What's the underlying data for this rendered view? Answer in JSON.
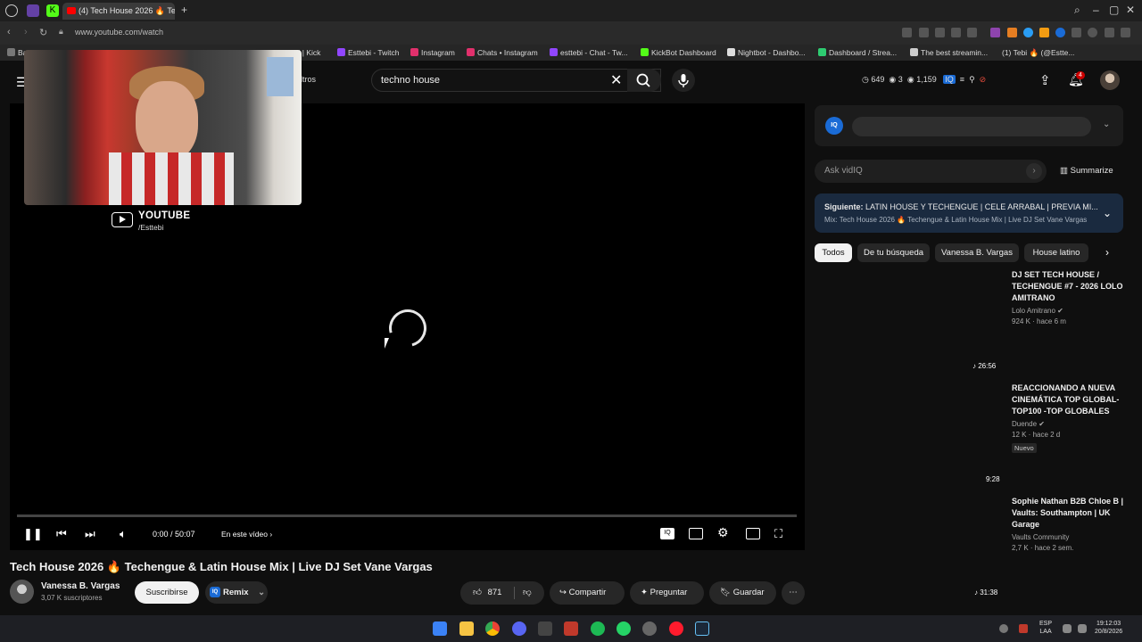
{
  "browser": {
    "active_tab_title": "(4) Tech House 2026 🔥 Te",
    "url": "www.youtube.com/watch",
    "bookmarks": [
      "Ba",
      "ebi | Kick",
      "Esttebi - Twitch",
      "Instagram",
      "Chats • Instagram",
      "esttebi - Chat - Tw...",
      "KickBot Dashboard",
      "Nightbot - Dashbo...",
      "Dashboard / Strea...",
      "The best streamin...",
      "(1) Tebi 🔥 (@Estte..."
    ]
  },
  "masthead": {
    "filters_label": "ltros",
    "search_value": "techno house",
    "stats": {
      "a": "649",
      "b": "3",
      "c": "1,159"
    },
    "notif_count": "4"
  },
  "player": {
    "overlay_title": "YOUTUBE",
    "overlay_handle": "/Esttebi",
    "time": "0:00 / 50:07",
    "chapter_label": "En este vídeo",
    "progress": 0
  },
  "video": {
    "title": "Tech House 2026 🔥 Techengue & Latin House Mix | Live DJ Set Vane Vargas",
    "channel": "Vanessa B. Vargas",
    "subscribers": "3,07 K suscriptores",
    "subscribe_label": "Suscribirse",
    "remix_label": "Remix",
    "likes": "871",
    "share_label": "Compartir",
    "ask_label": "Preguntar",
    "save_label": "Guardar"
  },
  "sidebar": {
    "ask_placeholder": "Ask vidIQ",
    "summarize_label": "Summarize",
    "next_prefix": "Siguiente:",
    "next_title": "LATIN HOUSE Y TECHENGUE | CELE ARRABAL | PREVIA MI...",
    "next_sub": "Mix: Tech House 2026 🔥 Techengue & Latin House Mix | Live DJ Set Vane Vargas",
    "chips": [
      "Todos",
      "De tu búsqueda",
      "Vanessa B. Vargas",
      "House latino"
    ],
    "recs": [
      {
        "title": "DJ SET TECH HOUSE / TECHENGUE #7 - 2026 LOLO AMITRANO",
        "channel": "Lolo Amitrano ✔",
        "meta": "924 K · hace 6 m",
        "duration": "26:56"
      },
      {
        "title": "REACCIONANDO A NUEVA CINEMÁTICA TOP GLOBAL- TOP100 -TOP GLOBALES",
        "channel": "Duende ✔",
        "meta": "12 K · hace 2 d",
        "badge": "Nuevo",
        "duration": "9:28"
      },
      {
        "title": "Sophie Nathan B2B Chloe B | Vaults: Southampton | UK Garage",
        "channel": "Vaults Community",
        "meta": "2,7 K · hace 2 sem.",
        "duration": "31:38"
      }
    ]
  },
  "taskbar": {
    "lang_top": "ESP",
    "lang_bottom": "LAA",
    "time": "19:12:03",
    "date": "20/8/2026"
  }
}
